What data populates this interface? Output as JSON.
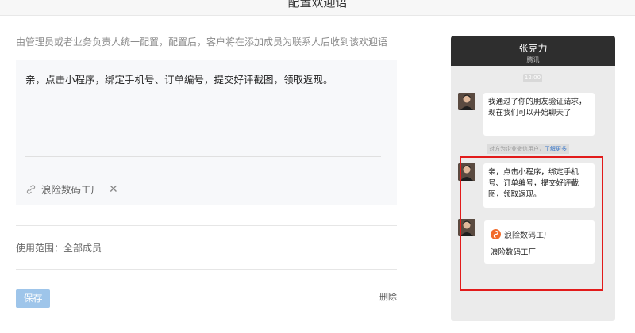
{
  "header": {
    "title": "配置欢迎语"
  },
  "description": "由管理员或者业务负责人统一配置，配置后，客户将在添加成员为联系人后收到该欢迎语",
  "editor": {
    "text": "亲，点击小程序，绑定手机号、订单编号，提交好评截图，领取返现。",
    "attachment": {
      "name": "浪险数码工厂",
      "remove_label": "✕"
    }
  },
  "scope": {
    "text": "使用范围：全部成员"
  },
  "actions": {
    "save_label": "保存",
    "delete_label": "删除"
  },
  "preview": {
    "contact_name": "张克力",
    "contact_sub": "腾讯",
    "time": "12:00",
    "friend_msg": "我通过了你的朋友验证请求，现在我们可以开始聊天了",
    "system_note": "对方为企业微信用户，",
    "system_more": "了解更多",
    "welcome_msg": "亲，点击小程序，绑定手机号、订单编号，提交好评截图，领取返现。",
    "card_title": "浪险数码工厂",
    "card_desc": "浪险数码工厂"
  },
  "colors": {
    "save_button": "#9ec5ea",
    "highlight_border": "#e21b1b",
    "phone_header": "#2e2e2e",
    "card_logo": "#f26a2a"
  }
}
